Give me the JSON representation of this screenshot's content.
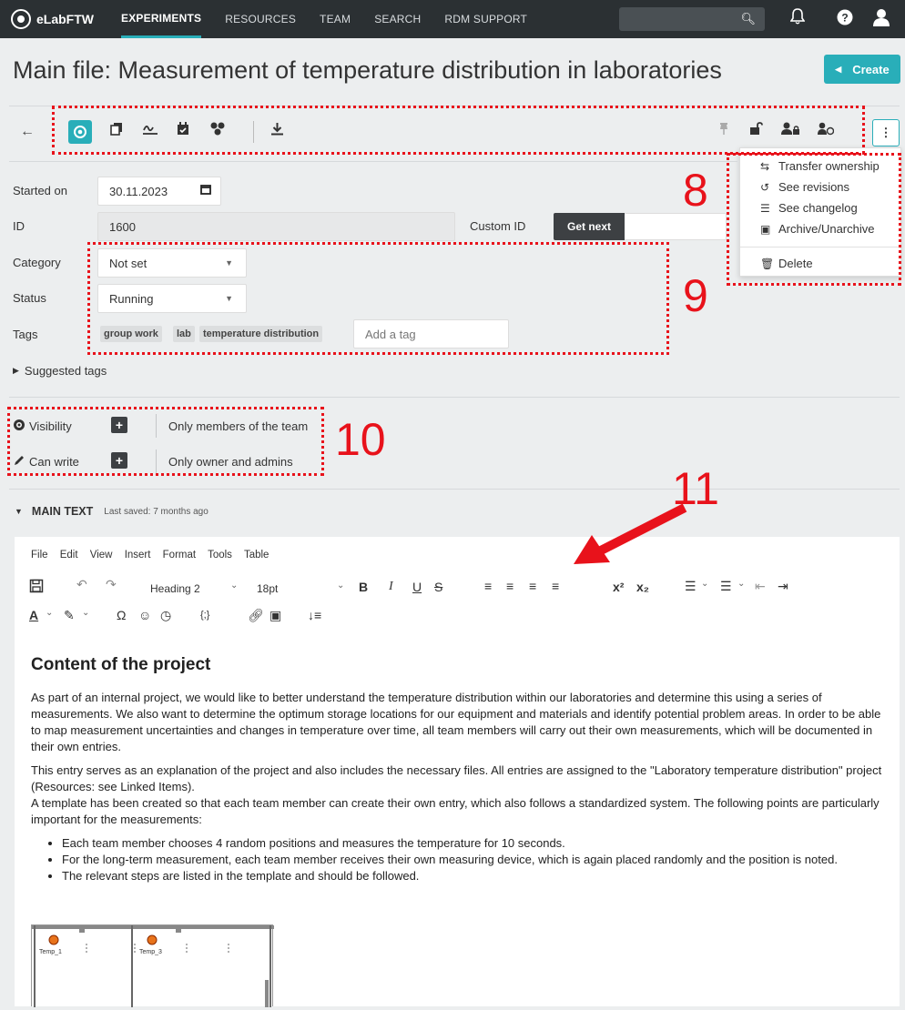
{
  "navbar": {
    "brand": "eLabFTW",
    "links": [
      "EXPERIMENTS",
      "RESOURCES",
      "TEAM",
      "SEARCH",
      "RDM SUPPORT"
    ]
  },
  "page": {
    "title": "Main file: Measurement of temperature distribution in laboratories",
    "create_label": "Create"
  },
  "dropdown": {
    "items": [
      "Transfer ownership",
      "See revisions",
      "See changelog",
      "Archive/Unarchive",
      "Delete"
    ]
  },
  "form": {
    "started_label": "Started on",
    "started_value": "30.11.2023",
    "id_label": "ID",
    "id_value": "1600",
    "custom_id_label": "Custom ID",
    "get_next": "Get next",
    "category_label": "Category",
    "category_value": "Not set",
    "status_label": "Status",
    "status_value": "Running",
    "tags_label": "Tags",
    "tags": [
      "group work",
      "lab",
      "temperature distribution"
    ],
    "tag_placeholder": "Add a tag",
    "suggested_tags": "Suggested tags"
  },
  "permissions": {
    "visibility_label": "Visibility",
    "visibility_value": "Only members of the team",
    "canwrite_label": "Can write",
    "canwrite_value": "Only owner and admins"
  },
  "maintext": {
    "label": "MAIN TEXT",
    "saved": "Last saved:  7 months ago"
  },
  "editor": {
    "menu": [
      "File",
      "Edit",
      "View",
      "Insert",
      "Format",
      "Tools",
      "Table"
    ],
    "block_format": "Heading 2",
    "font_size": "18pt",
    "content_title": "Content of the project",
    "para1": "As part of an internal project, we would like to better understand the temperature distribution within our laboratories and determine this using a series of measurements. We also want to determine the optimum storage locations for our equipment and materials and identify potential problem areas. In order to be able to map measurement uncertainties and changes in temperature over time, all team members will carry out their own measurements, which will be documented in their own entries.",
    "para2": "This entry serves as an explanation of the project and also includes the necessary files. All entries are assigned to the \"Laboratory temperature distribution\" project (Resources: see Linked Items).",
    "para3": "A template has been created so that each team member can create their own entry, which also follows a standardized system. The following points are particularly important for the measurements:",
    "bullets": [
      "Each team member chooses 4 random positions and measures the temperature for 10 seconds.",
      "For the long-term measurement, each team member receives their own measuring device, which is again placed randomly and the position is noted.",
      "The relevant steps are listed in the template and should be followed."
    ],
    "floorplan_labels": [
      "Temp_1",
      "Temp_3"
    ]
  },
  "annotations": [
    "8",
    "9",
    "10",
    "11"
  ],
  "colors": {
    "accent": "#29aeb9",
    "navbar": "#2b3033",
    "annotation": "#e8121b"
  }
}
